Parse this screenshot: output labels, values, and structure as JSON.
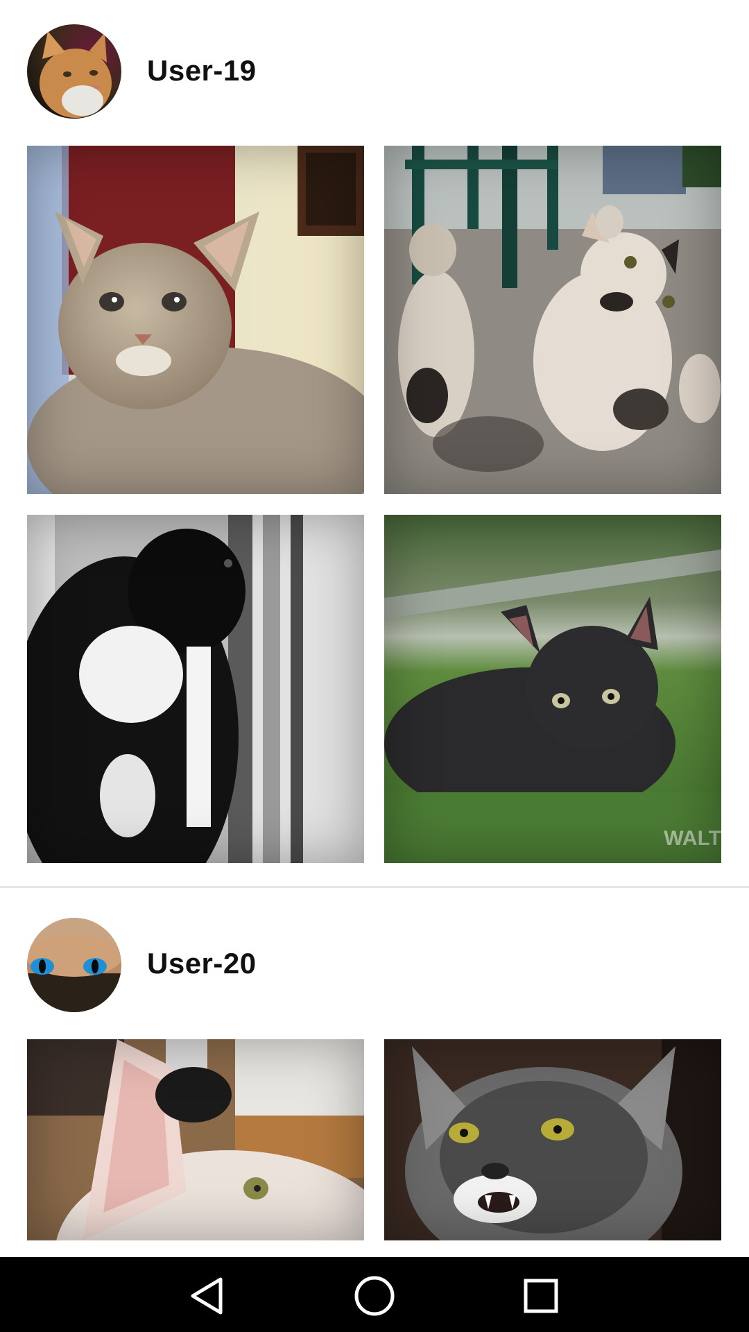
{
  "posts": [
    {
      "username": "User-19",
      "avatar": "orange-cat-avatar",
      "photos": [
        {
          "subject": "tabby-kitten-photo"
        },
        {
          "subject": "calico-cats-under-chairs-photo"
        },
        {
          "subject": "black-white-cat-window-photo"
        },
        {
          "subject": "black-kitten-grass-photo",
          "watermark": "WALT"
        }
      ]
    },
    {
      "username": "User-20",
      "avatar": "blue-eyed-cat-avatar",
      "photos": [
        {
          "subject": "white-cat-closeup-photo"
        },
        {
          "subject": "grey-tabby-hissing-photo"
        }
      ]
    }
  ],
  "navigation": {
    "back": "back-triangle-icon",
    "home": "home-circle-icon",
    "recents": "recents-square-icon"
  },
  "colors": {
    "background": "#ffffff",
    "navbar": "#000000",
    "divider": "#e6e6e6"
  }
}
